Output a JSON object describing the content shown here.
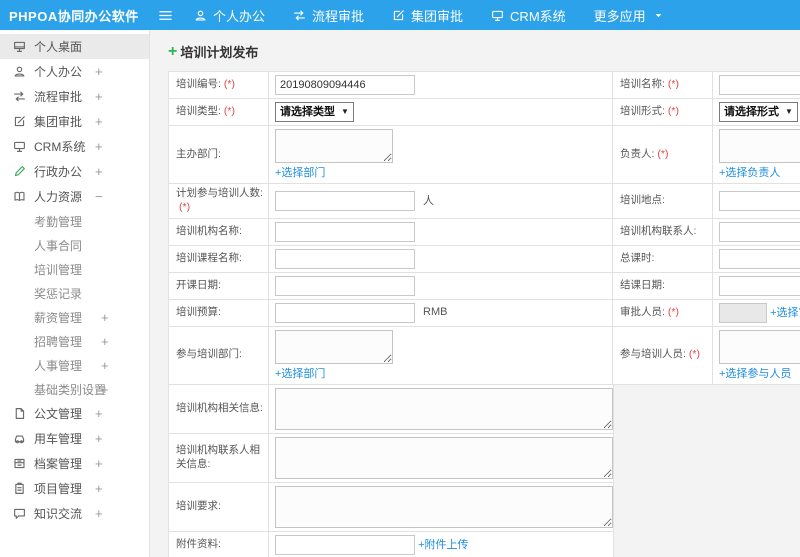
{
  "topbar": {
    "brand": "PHPOA协同办公软件",
    "nav": [
      {
        "label": "个人办公"
      },
      {
        "label": "流程审批"
      },
      {
        "label": "集团审批"
      },
      {
        "label": "CRM系统"
      },
      {
        "label": "更多应用"
      }
    ]
  },
  "sidebar": {
    "items": [
      {
        "label": "个人桌面",
        "expander": ""
      },
      {
        "label": "个人办公",
        "expander": "+"
      },
      {
        "label": "流程审批",
        "expander": "+"
      },
      {
        "label": "集团审批",
        "expander": "+"
      },
      {
        "label": "CRM系统",
        "expander": "+"
      },
      {
        "label": "行政办公",
        "expander": "+"
      },
      {
        "label": "人力资源",
        "expander": "−"
      },
      {
        "label": "考勤管理",
        "expander": ""
      },
      {
        "label": "人事合同",
        "expander": ""
      },
      {
        "label": "培训管理",
        "expander": ""
      },
      {
        "label": "奖惩记录",
        "expander": ""
      },
      {
        "label": "薪资管理",
        "expander": "+"
      },
      {
        "label": "招聘管理",
        "expander": "+"
      },
      {
        "label": "人事管理",
        "expander": "+"
      },
      {
        "label": "基础类别设置",
        "expander": "+"
      },
      {
        "label": "公文管理",
        "expander": "+"
      },
      {
        "label": "用车管理",
        "expander": "+"
      },
      {
        "label": "档案管理",
        "expander": "+"
      },
      {
        "label": "项目管理",
        "expander": "+"
      },
      {
        "label": "知识交流",
        "expander": "+"
      }
    ]
  },
  "page": {
    "title": "培训计划发布",
    "title_icon": "+"
  },
  "form": {
    "fields": {
      "number": {
        "label": "培训编号:",
        "required": "(*)",
        "value": "20190809094446"
      },
      "name": {
        "label": "培训名称:",
        "required": "(*)"
      },
      "type": {
        "label": "培训类型:",
        "required": "(*)",
        "value": "请选择类型"
      },
      "mode": {
        "label": "培训形式:",
        "required": "(*)",
        "value": "请选择形式"
      },
      "host_dept": {
        "label": "主办部门:",
        "link": "+选择部门"
      },
      "leader": {
        "label": "负责人:",
        "required": "(*)",
        "link": "+选择负责人"
      },
      "planned_count": {
        "label": "计划参与培训人数:",
        "required": "(*)",
        "suffix": "人"
      },
      "location": {
        "label": "培训地点:"
      },
      "org_name": {
        "label": "培训机构名称:"
      },
      "org_contact": {
        "label": "培训机构联系人:"
      },
      "course_name": {
        "label": "培训课程名称:"
      },
      "total_hours": {
        "label": "总课时:"
      },
      "start_date": {
        "label": "开课日期:"
      },
      "end_date": {
        "label": "结课日期:"
      },
      "budget": {
        "label": "培训预算:",
        "suffix": "RMB"
      },
      "approver": {
        "label": "审批人员:",
        "required": "(*)",
        "link": "+选择审批人员"
      },
      "join_depts": {
        "label": "参与培训部门:",
        "link": "+选择部门"
      },
      "join_people": {
        "label": "参与培训人员:",
        "required": "(*)",
        "link": "+选择参与人员"
      },
      "org_info": {
        "label": "培训机构相关信息:"
      },
      "org_contact_info": {
        "label": "培训机构联系人相关信息:"
      },
      "requirements": {
        "label": "培训要求:"
      },
      "attachment": {
        "label": "附件资料:",
        "link": "+附件上传"
      }
    }
  },
  "colors": {
    "topbar": "#2ba2ea",
    "link": "#1d8ce0",
    "required": "#e64444",
    "title_plus": "#2eb84b"
  }
}
